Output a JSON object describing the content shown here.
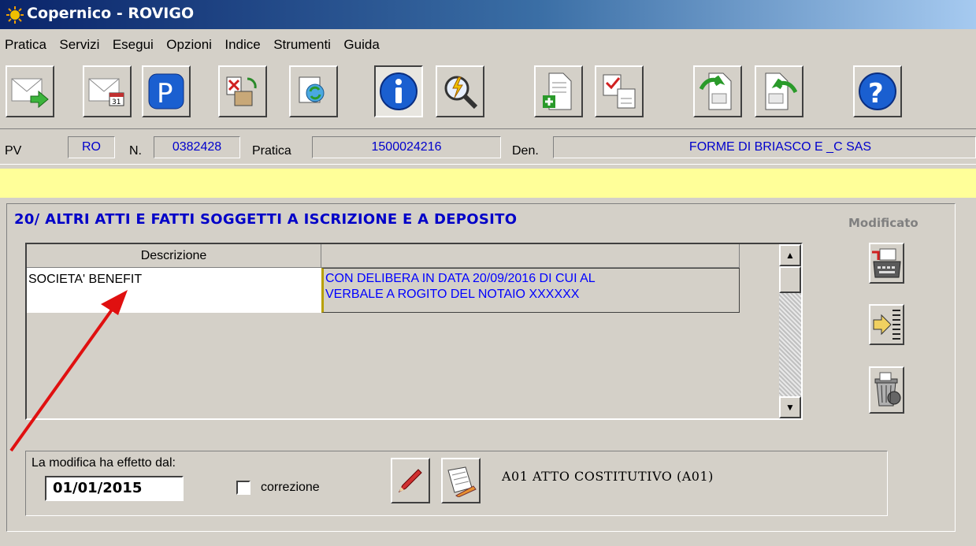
{
  "window": {
    "title": "Copernico - ROVIGO"
  },
  "menu": [
    "Pratica",
    "Servizi",
    "Esegui",
    "Opzioni",
    "Indice",
    "Strumenti",
    "Guida"
  ],
  "toolbar": {
    "icons": [
      "envelope-send-icon",
      "envelope-calendar-icon",
      "p-icon",
      "hands-document-icon",
      "document-refresh-icon",
      "info-icon",
      "search-lightning-icon",
      "document-add-icon",
      "documents-check-icon",
      "document-undo-icon",
      "document-redo-icon",
      "help-icon"
    ]
  },
  "infobar": {
    "pv_label": "PV",
    "pv_value": "RO",
    "n_label": "N.",
    "n_value": "0382428",
    "pratica_label": "Pratica",
    "pratica_value": "1500024216",
    "den_label": "Den.",
    "den_value": "FORME DI BRIASCO E _C SAS"
  },
  "section": {
    "title": "20/ ALTRI ATTI E FATTI SOGGETTI A ISCRIZIONE E A DEPOSITO",
    "status": "Modificato"
  },
  "grid": {
    "columns": [
      "Descrizione",
      ""
    ],
    "rows": [
      {
        "descrizione": "SOCIETA' BENEFIT",
        "detail_line1": "CON DELIBERA IN DATA 20/09/2016 DI CUI AL",
        "detail_line2": "VERBALE A ROGITO DEL NOTAIO XXXXXX"
      }
    ]
  },
  "footer": {
    "effect_label": "La modifica ha effetto dal:",
    "effect_date": "01/01/2015",
    "correzione_label": "correzione",
    "atto": "A01 ATTO COSTITUTIVO (A01)"
  },
  "colors": {
    "title_blue": "#0000c8",
    "highlight_yellow": "#ffff99",
    "arrow_red": "#e01010"
  }
}
